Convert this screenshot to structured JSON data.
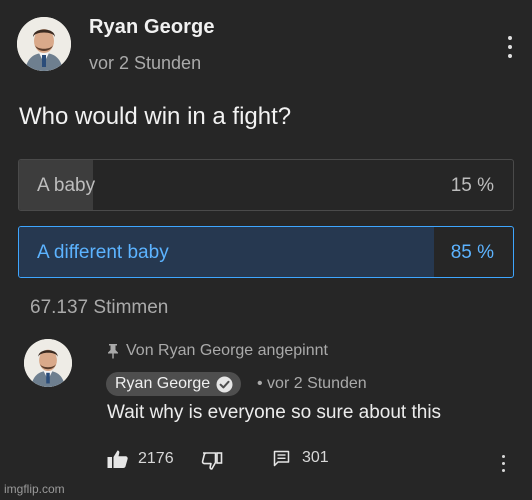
{
  "post": {
    "author": "Ryan George",
    "time": "vor 2 Stunden",
    "question": "Who would win in a fight?",
    "poll": {
      "options": [
        {
          "label": "A baby",
          "percent_text": "15 %",
          "percent": 15,
          "selected": false
        },
        {
          "label": "A different baby",
          "percent_text": "85 %",
          "percent": 85,
          "selected": true
        }
      ],
      "votes": "67.137 Stimmen"
    }
  },
  "comment": {
    "pinned_text": "Von Ryan George angepinnt",
    "author": "Ryan George",
    "time": "• vor 2 Stunden",
    "text": "Wait why is everyone so sure about this",
    "likes": "2176",
    "replies": "301"
  },
  "watermark": "imgflip.com",
  "icons": {
    "menu": "more-vertical-icon",
    "pin": "pin-icon",
    "verified": "verified-check-icon",
    "like": "thumbs-up-icon",
    "dislike": "thumbs-down-icon",
    "reply": "comment-icon"
  },
  "colors": {
    "background": "#262626",
    "accent": "#3ea6ff",
    "selected_fill": "#263850",
    "option_fill": "#3d3d3d"
  }
}
